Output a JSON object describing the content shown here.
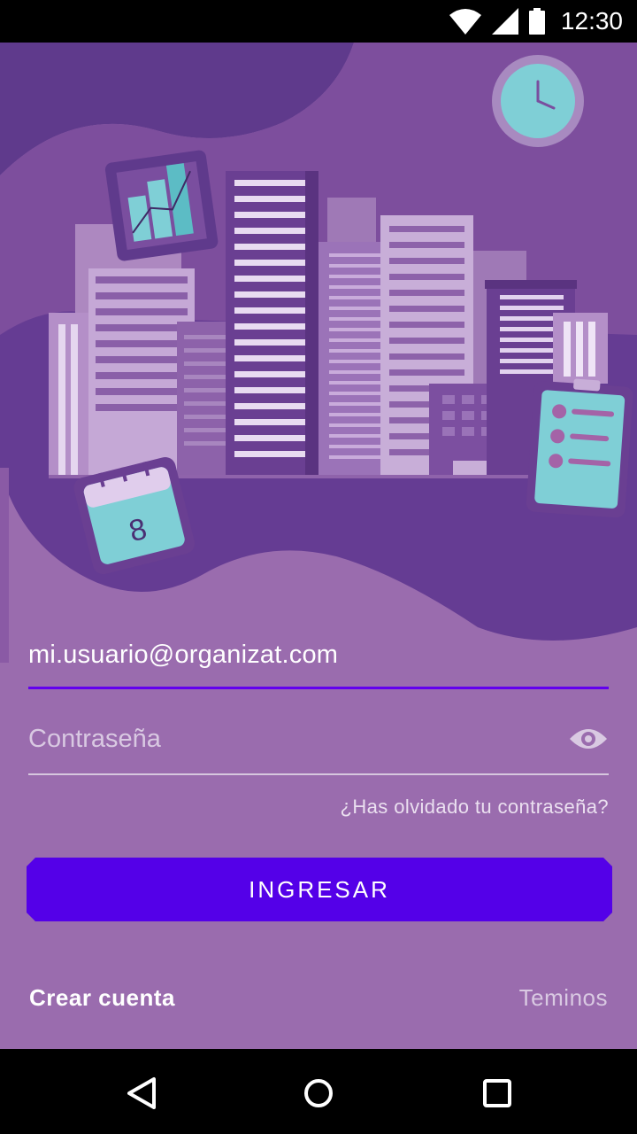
{
  "status_bar": {
    "time": "12:30",
    "icons": [
      "wifi-icon",
      "cellular-signal-icon",
      "battery-icon"
    ]
  },
  "illustration": {
    "calendar_day": "8",
    "icons": [
      "bar-chart-icon",
      "clock-icon",
      "calendar-icon",
      "checklist-icon"
    ]
  },
  "login": {
    "email_value": "mi.usuario@organizat.com",
    "password_placeholder": "Contraseña",
    "forgot_password": "¿Has olvidado tu contraseña?",
    "submit_label": "INGRESAR",
    "create_account": "Crear cuenta",
    "terms": "Teminos"
  },
  "nav_bar": {
    "icons": [
      "back-icon",
      "home-icon",
      "recents-icon"
    ]
  },
  "colors": {
    "background": "#9a6cae",
    "accent": "#6200ee",
    "button": "#5400e8",
    "illustration_dark": "#5f3a8c",
    "illustration_teal": "#7fcfd6"
  }
}
